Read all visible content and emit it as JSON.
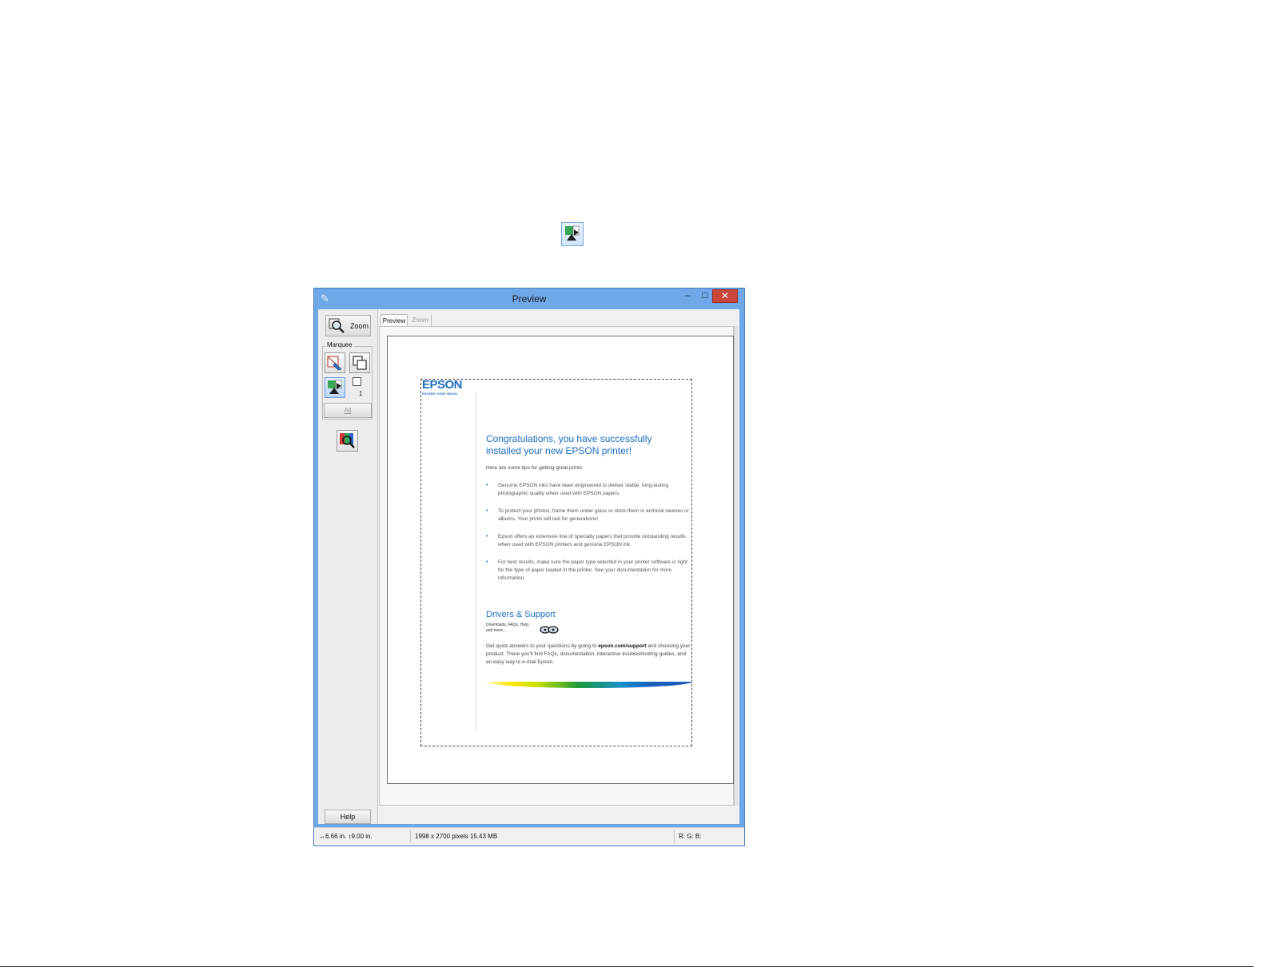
{
  "window": {
    "title": "Preview",
    "controls": {
      "minimize": "–",
      "maximize": "□",
      "close": "✕"
    }
  },
  "toolbar": {
    "zoom_label": "Zoom",
    "marquee_label": "Marquee",
    "marquee_count": "1",
    "all_label": "All",
    "help_label": "Help"
  },
  "tabs": [
    {
      "label": "Preview",
      "active": true
    },
    {
      "label": "Zoom",
      "active": false
    }
  ],
  "document": {
    "logo": "EPSON",
    "tagline": "EXCEED YOUR VISION",
    "title": "Congratulations, you have successfully installed your new EPSON printer!",
    "intro": "Here are some tips for getting great prints:",
    "bullets": [
      "Genuine EPSON inks have been engineered to deliver stable, long-lasting photographic quality when used with EPSON papers.",
      "To protect your photos, frame them under glass or store them in archival sleeves or albums. Your prints will last for generations!",
      "Epson offers an extensive line of specialty papers that provide outstanding results when used with EPSON printers and genuine EPSON ink.",
      "For best results, make sure the paper type selected in your printer software is right for the type of paper loaded in the printer. See your documentation for more information."
    ],
    "drivers_heading": "Drivers & Support",
    "downloads_text": "Downloads, FAQs, Help, and more...",
    "support_before": "Get quick answers to your questions by going to ",
    "support_link": "epson.com/support",
    "support_after": " and choosing your product. There you'll find FAQs, documentation, interactive troubleshooting guides, and an easy way to e-mail Epson."
  },
  "status": {
    "width": "6.66 in.",
    "height": "9.00 in.",
    "pixels": "1998 x 2700 pixels 15.43 MB",
    "rgb": "R: G: B:"
  },
  "colors": {
    "title_bar": "#6fa8e8",
    "close_button": "#c9463d",
    "epson_blue": "#1b6dc1"
  }
}
